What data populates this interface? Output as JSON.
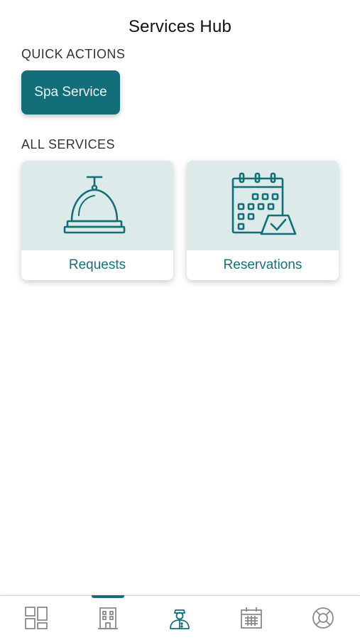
{
  "header": {
    "title": "Services Hub"
  },
  "quick_actions": {
    "label": "QUICK ACTIONS",
    "buttons": [
      {
        "label": "Spa Service"
      }
    ]
  },
  "all_services": {
    "label": "ALL SERVICES",
    "cards": [
      {
        "label": "Requests",
        "icon": "service-bell-icon"
      },
      {
        "label": "Reservations",
        "icon": "calendar-check-icon"
      }
    ]
  },
  "tab_bar": {
    "tabs": [
      {
        "icon": "dashboard-icon"
      },
      {
        "icon": "hotel-icon",
        "selected": true
      },
      {
        "icon": "concierge-icon"
      },
      {
        "icon": "calendar-icon"
      },
      {
        "icon": "lifebuoy-icon"
      }
    ]
  },
  "colors": {
    "accent": "#126e78",
    "card_art_background": "#dceaea",
    "icon_inactive": "#8a8a8a"
  }
}
